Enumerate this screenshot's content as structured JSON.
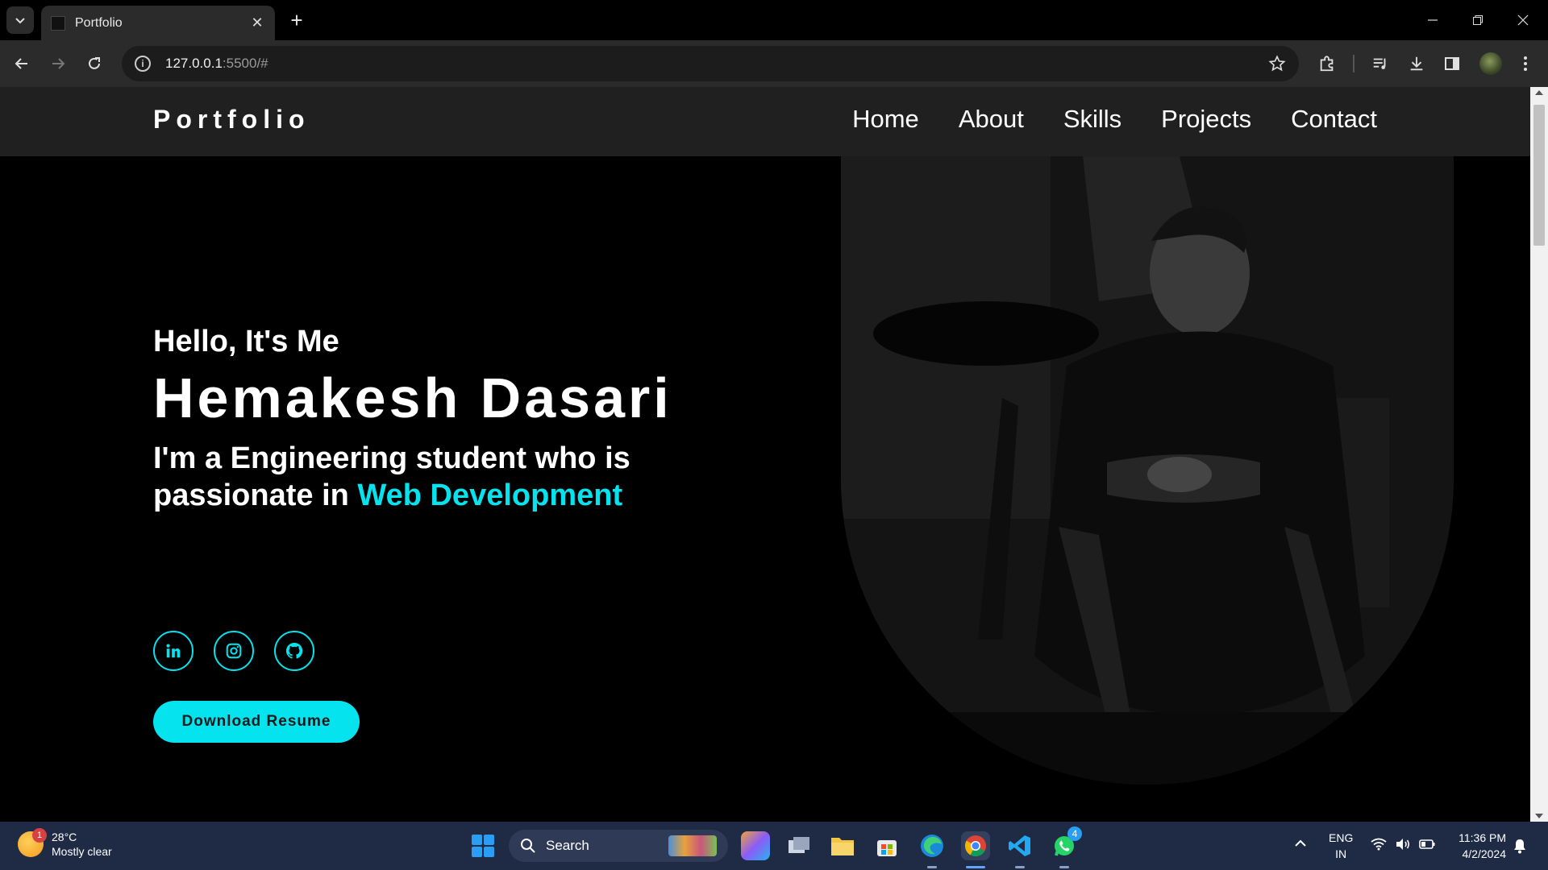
{
  "browser": {
    "tab_title": "Portfolio",
    "url_host": "127.0.0.1",
    "url_rest": ":5500/#"
  },
  "site": {
    "logo": "Portfolio",
    "nav": [
      "Home",
      "About",
      "Skills",
      "Projects",
      "Contact"
    ],
    "hero": {
      "greeting": "Hello, It's Me",
      "name": "Hemakesh Dasari",
      "tagline_prefix": "I'm a Engineering student who is passionate in ",
      "tagline_accent": "Web Development",
      "resume_button": "Download Resume"
    },
    "socials": [
      "linkedin-icon",
      "instagram-icon",
      "github-icon"
    ],
    "accent_color": "#04e3ee"
  },
  "taskbar": {
    "weather_badge": "1",
    "temperature": "28°C",
    "weather": "Mostly clear",
    "search_label": "Search",
    "whatsapp_badge": "4",
    "lang_top": "ENG",
    "lang_bottom": "IN",
    "time": "11:36 PM",
    "date": "4/2/2024"
  }
}
